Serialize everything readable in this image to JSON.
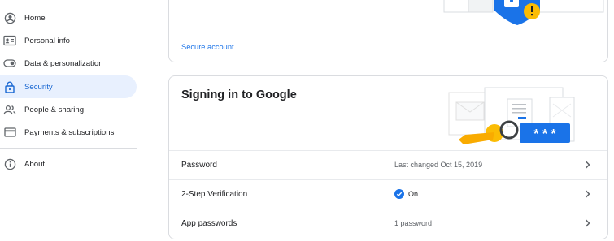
{
  "sidebar": {
    "items": [
      {
        "label": "Home",
        "icon": "home-icon"
      },
      {
        "label": "Personal info",
        "icon": "id-card-icon"
      },
      {
        "label": "Data & personalization",
        "icon": "toggle-icon"
      },
      {
        "label": "Security",
        "icon": "lock-icon",
        "active": true
      },
      {
        "label": "People & sharing",
        "icon": "people-icon"
      },
      {
        "label": "Payments & subscriptions",
        "icon": "credit-card-icon"
      },
      {
        "label": "About",
        "icon": "info-icon"
      }
    ]
  },
  "security_card": {
    "link_label": "Secure account"
  },
  "signin_card": {
    "title": "Signing in to Google",
    "illustration_pin": "* * *",
    "rows": [
      {
        "label": "Password",
        "value": "Last changed Oct 15, 2019"
      },
      {
        "label": "2-Step Verification",
        "value": "On",
        "status": "check-icon"
      },
      {
        "label": "App passwords",
        "value": "1 password"
      }
    ]
  },
  "colors": {
    "accent": "#1a73e8",
    "active_bg": "#e8f0fe",
    "warning": "#f9ab00",
    "key": "#fbbc04"
  }
}
